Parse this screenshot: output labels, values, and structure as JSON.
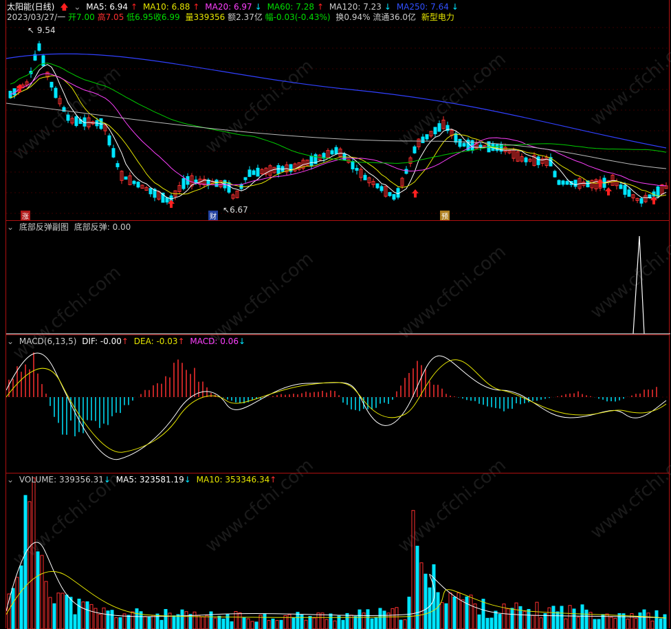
{
  "stock": {
    "title": "太阳能(日线)",
    "ma5": "MA5: 6.94",
    "ma10": "MA10: 6.88",
    "ma20": "MA20: 6.97",
    "ma60": "MA60: 7.28",
    "ma120": "MA120: 7.23",
    "ma250": "MA250: 7.64",
    "date": "2023/03/27/一",
    "open": "开7.00",
    "high": "高7.05",
    "low": "低6.95",
    "close": "收6.99",
    "vol": "量339356",
    "amount": "额2.37亿",
    "change": "幅-0.03(-0.43%)",
    "turnover": "换0.94%",
    "float": "流通36.0亿",
    "sector": "新型电力",
    "peak_label": "9.54",
    "trough_label": "6.67",
    "marker_zhang": "涨",
    "marker_cai": "财",
    "marker_yu": "预"
  },
  "indicator": {
    "title": "底部反弹副图",
    "value": "底部反弹: 0.00"
  },
  "macd": {
    "title": "MACD(6,13,5)",
    "dif": "DIF: -0.00",
    "dea": "DEA: -0.03",
    "macd": "MACD: 0.06"
  },
  "volume": {
    "title": "VOLUME: 339356.31",
    "ma5": "MA5: 323581.19",
    "ma10": "MA10: 353346.34"
  },
  "watermark": "www.cfchi.com",
  "colors": {
    "up": "#ff3030",
    "down": "#00e5ff",
    "ma5": "#ffffff",
    "ma10": "#e6e600",
    "ma20": "#ff40ff",
    "ma60": "#00cc00",
    "ma120": "#bbbbbb",
    "ma250": "#3040ff"
  }
}
